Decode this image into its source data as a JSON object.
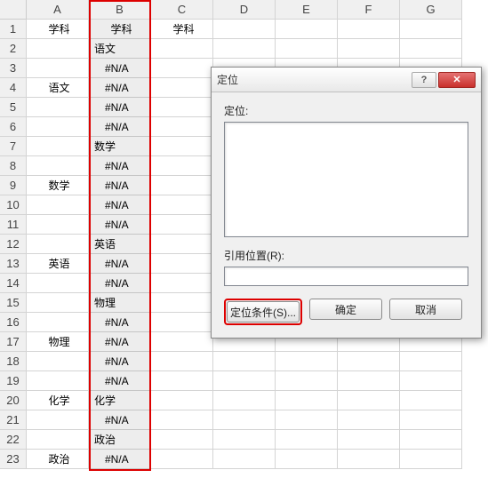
{
  "columns": [
    "A",
    "B",
    "C",
    "D",
    "E",
    "F",
    "G"
  ],
  "rows_count": 23,
  "col_a_header": "学科",
  "col_b_header": "学科",
  "col_c_header": "学科",
  "col_a": {
    "r4": "语文",
    "r9": "数学",
    "r13": "英语",
    "r17": "物理",
    "r20": "化学",
    "r23": "政治"
  },
  "col_b": {
    "r2": {
      "v": "语文",
      "pad": "b"
    },
    "r3": {
      "v": "#N/A",
      "pad": "bpad"
    },
    "r4": {
      "v": "#N/A",
      "pad": "bpad"
    },
    "r5": {
      "v": "#N/A",
      "pad": "bpad"
    },
    "r6": {
      "v": "#N/A",
      "pad": "bpad"
    },
    "r7": {
      "v": "数学",
      "pad": "b"
    },
    "r8": {
      "v": "#N/A",
      "pad": "bpad"
    },
    "r9": {
      "v": "#N/A",
      "pad": "bpad"
    },
    "r10": {
      "v": "#N/A",
      "pad": "bpad"
    },
    "r11": {
      "v": "#N/A",
      "pad": "bpad"
    },
    "r12": {
      "v": "英语",
      "pad": "b"
    },
    "r13": {
      "v": "#N/A",
      "pad": "bpad"
    },
    "r14": {
      "v": "#N/A",
      "pad": "bpad"
    },
    "r15": {
      "v": "物理",
      "pad": "b"
    },
    "r16": {
      "v": "#N/A",
      "pad": "bpad"
    },
    "r17": {
      "v": "#N/A",
      "pad": "bpad"
    },
    "r18": {
      "v": "#N/A",
      "pad": "bpad"
    },
    "r19": {
      "v": "#N/A",
      "pad": "bpad"
    },
    "r20": {
      "v": "化学",
      "pad": "b"
    },
    "r21": {
      "v": "#N/A",
      "pad": "bpad"
    },
    "r22": {
      "v": "政治",
      "pad": "b"
    },
    "r23": {
      "v": "#N/A",
      "pad": "bpad"
    }
  },
  "dialog": {
    "title": "定位",
    "label_goto": "定位:",
    "label_ref": "引用位置(R):",
    "ref_value": "",
    "btn_special": "定位条件(S)...",
    "btn_ok": "确定",
    "btn_cancel": "取消"
  }
}
